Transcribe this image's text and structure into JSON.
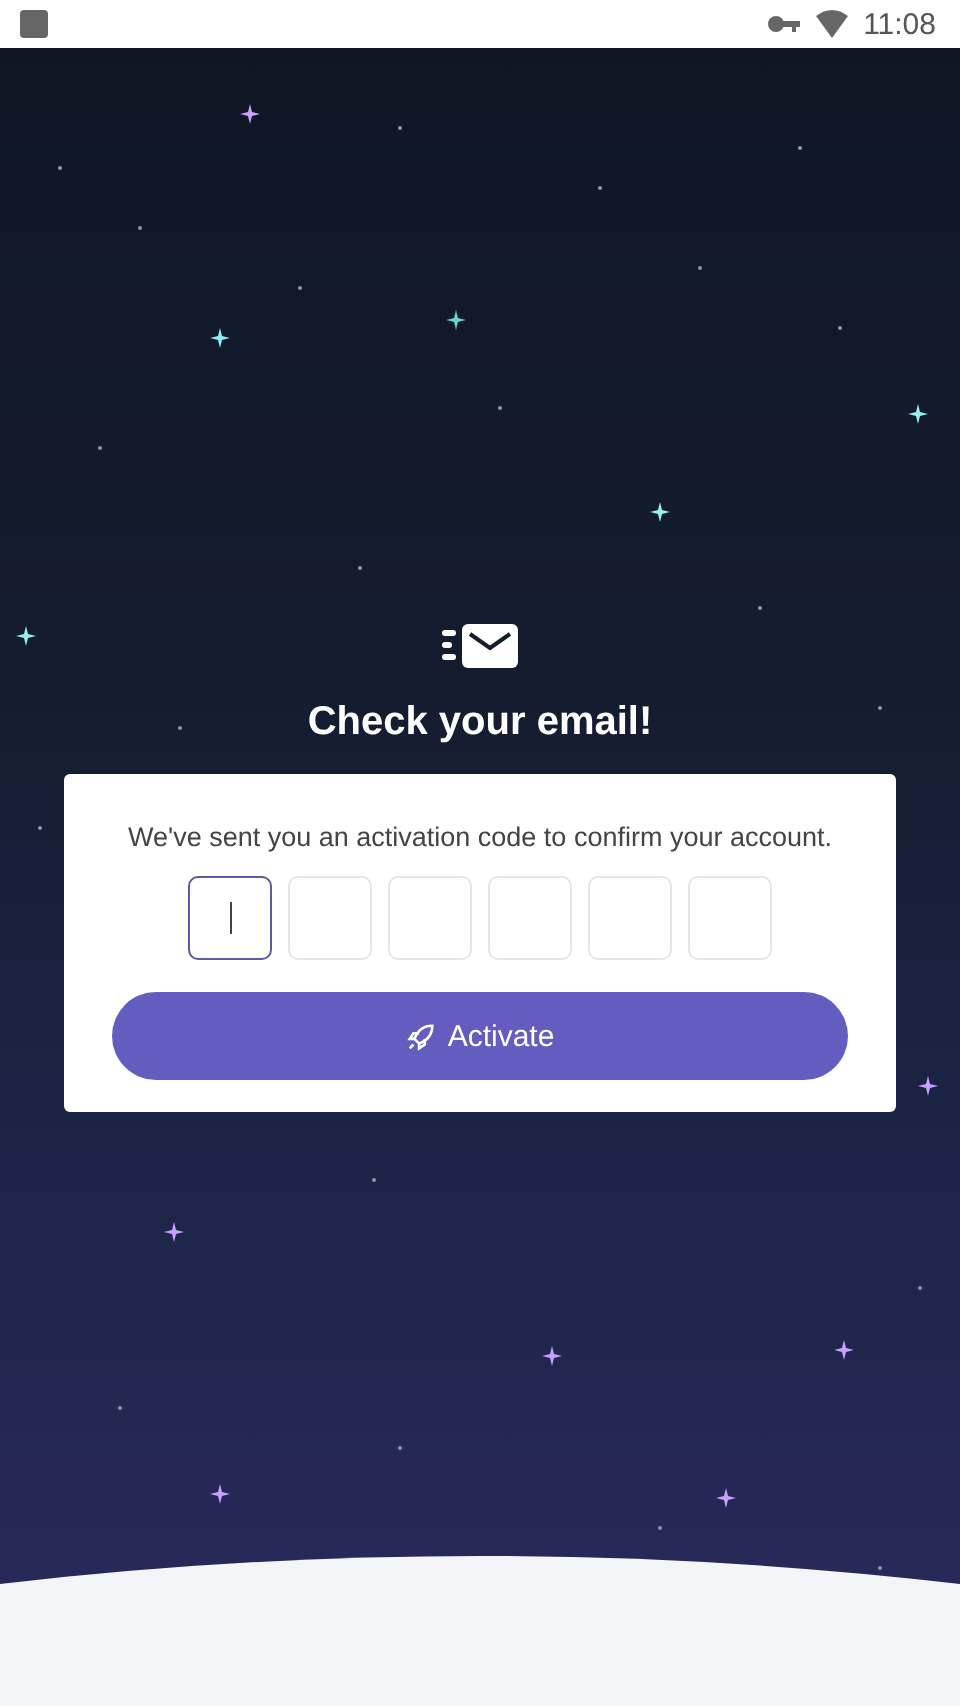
{
  "status_bar": {
    "time": "11:08"
  },
  "title": "Check your email!",
  "card": {
    "message": "We've sent you an activation code to confirm your account.",
    "code_boxes": [
      {
        "focused": true
      },
      {
        "focused": false
      },
      {
        "focused": false
      },
      {
        "focused": false
      },
      {
        "focused": false
      },
      {
        "focused": false
      }
    ],
    "button": "Activate"
  }
}
